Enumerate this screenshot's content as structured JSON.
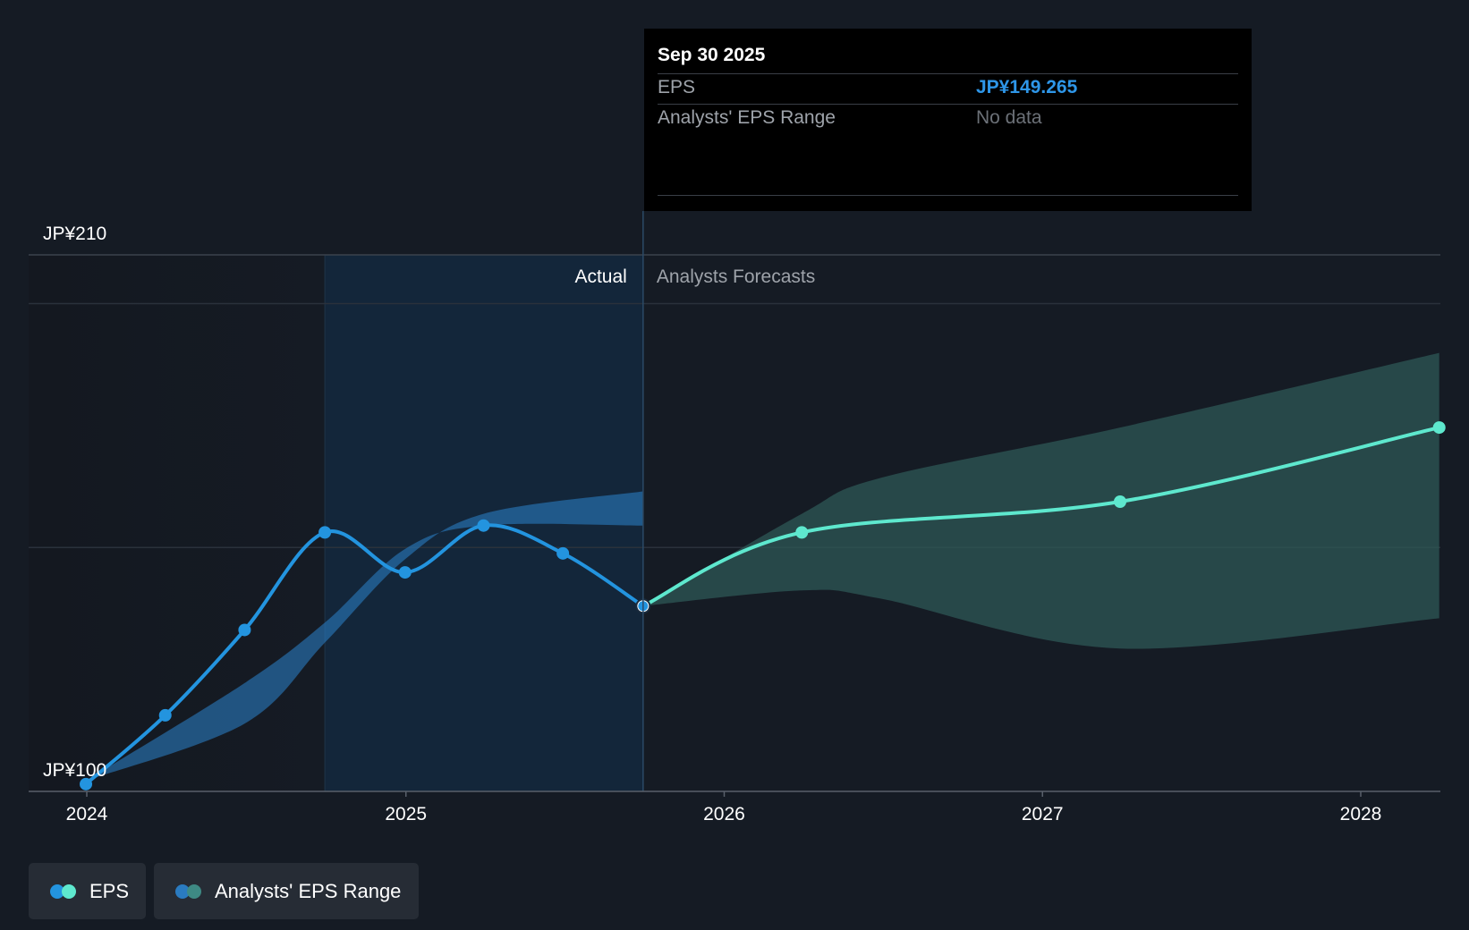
{
  "chart_data": {
    "type": "line",
    "y_axis": {
      "top_label": "JP¥210",
      "bottom_label": "JP¥100",
      "ylim": [
        100,
        210
      ]
    },
    "x_axis": {
      "ticks": [
        "2024",
        "2025",
        "2026",
        "2027",
        "2028"
      ]
    },
    "divider_labels": {
      "actual": "Actual",
      "forecast": "Analysts Forecasts"
    },
    "series": [
      {
        "name": "EPS",
        "color": "#2394df",
        "points": [
          {
            "date": "2023-12-31",
            "value": 101.5
          },
          {
            "date": "2024-03-31",
            "value": 115.6
          },
          {
            "date": "2024-06-30",
            "value": 133.1
          },
          {
            "date": "2024-09-30",
            "value": 153.1
          },
          {
            "date": "2024-12-31",
            "value": 144.9
          },
          {
            "date": "2025-03-31",
            "value": 154.5
          },
          {
            "date": "2025-06-30",
            "value": 148.8
          },
          {
            "date": "2025-09-30",
            "value": 138.0
          }
        ]
      },
      {
        "name": "EPS",
        "color": "#5ee8ce",
        "points": [
          {
            "date": "2025-09-30",
            "value": 138.0
          },
          {
            "date": "2026-03-31",
            "value": 153.1
          },
          {
            "date": "2027-03-31",
            "value": 159.4
          },
          {
            "date": "2028-03-31",
            "value": 174.6
          }
        ]
      }
    ],
    "ranges": [
      {
        "name": "Analysts' EPS Range",
        "color": "#2a7bc0",
        "upper": [
          {
            "date": "2023-12-31",
            "value": 102.2
          },
          {
            "date": "2024-06-30",
            "value": 113.9
          },
          {
            "date": "2024-09-30",
            "value": 130.5
          },
          {
            "date": "2024-12-31",
            "value": 147.6
          },
          {
            "date": "2025-03-31",
            "value": 156.9
          },
          {
            "date": "2025-09-30",
            "value": 161.5
          }
        ],
        "lower": [
          {
            "date": "2023-12-31",
            "value": 102.2
          },
          {
            "date": "2024-06-30",
            "value": 122.2
          },
          {
            "date": "2024-09-30",
            "value": 134.6
          },
          {
            "date": "2024-12-31",
            "value": 149.7
          },
          {
            "date": "2025-03-31",
            "value": 154.5
          },
          {
            "date": "2025-09-30",
            "value": 154.5
          }
        ]
      },
      {
        "name": "Analysts' EPS Range",
        "color": "#2e5856",
        "upper": [
          {
            "date": "2025-09-30",
            "value": 138.0
          },
          {
            "date": "2026-03-31",
            "value": 156.9
          },
          {
            "date": "2026-06-30",
            "value": 164.3
          },
          {
            "date": "2027-03-31",
            "value": 174.6
          },
          {
            "date": "2028-03-31",
            "value": 189.9
          }
        ],
        "lower": [
          {
            "date": "2025-09-30",
            "value": 138.0
          },
          {
            "date": "2026-03-31",
            "value": 141.2
          },
          {
            "date": "2026-06-30",
            "value": 139.5
          },
          {
            "date": "2027-03-31",
            "value": 129.3
          },
          {
            "date": "2028-03-31",
            "value": 135.5
          }
        ]
      }
    ],
    "grid": true,
    "highlight": {
      "start": "2024-09-30",
      "end": "2025-09-30"
    }
  },
  "tooltip": {
    "date": "Sep 30 2025",
    "rows": [
      {
        "key": "EPS",
        "value": "JP¥149.265"
      },
      {
        "key": "Analysts' EPS Range",
        "value": "No data"
      }
    ]
  },
  "legend": [
    {
      "label": "EPS",
      "colors": [
        "#2394df",
        "#5ee8ce"
      ]
    },
    {
      "label": "Analysts' EPS Range",
      "colors": [
        "#2a7bc0",
        "#3e8a84"
      ]
    }
  ]
}
